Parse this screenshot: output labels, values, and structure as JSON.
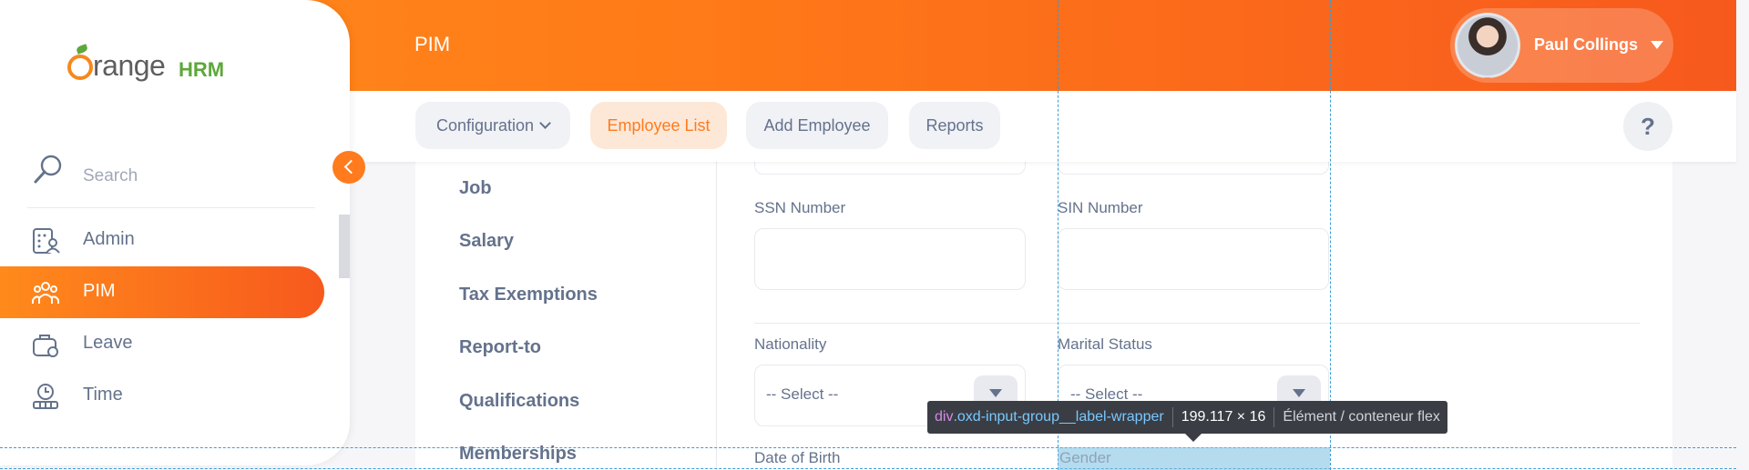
{
  "header": {
    "title": "PIM",
    "user": {
      "name": "Paul Collings"
    }
  },
  "tabs": [
    {
      "label": "Configuration"
    },
    {
      "label": "Employee List"
    },
    {
      "label": "Add Employee"
    },
    {
      "label": "Reports"
    }
  ],
  "help_label": "?",
  "sidebar": {
    "logo_text": "range",
    "logo_hrm": "HRM",
    "search_placeholder": "Search",
    "items": [
      {
        "label": "Admin",
        "icon": "admin-icon"
      },
      {
        "label": "PIM",
        "icon": "pim-icon",
        "active": true
      },
      {
        "label": "Leave",
        "icon": "leave-icon"
      },
      {
        "label": "Time",
        "icon": "time-icon"
      }
    ]
  },
  "side_menu": [
    "Job",
    "Salary",
    "Tax Exemptions",
    "Report-to",
    "Qualifications",
    "Memberships"
  ],
  "form": {
    "ssn_label": "SSN Number",
    "sin_label": "SIN Number",
    "nationality_label": "Nationality",
    "nationality_value": "-- Select --",
    "marital_label": "Marital Status",
    "marital_value": "-- Select --",
    "dob_label": "Date of Birth",
    "gender_label": "Gender"
  },
  "devtools_tooltip": {
    "tag": "div",
    "class": ".oxd-input-group__label-wrapper",
    "size": "199.117 × 16",
    "description": "Élément / conteneur flex"
  },
  "colors": {
    "accent": "#ff7b1d",
    "header_gradient_start": "#ff8a1b",
    "header_gradient_end": "#f7591d",
    "text_muted": "#64728c"
  }
}
